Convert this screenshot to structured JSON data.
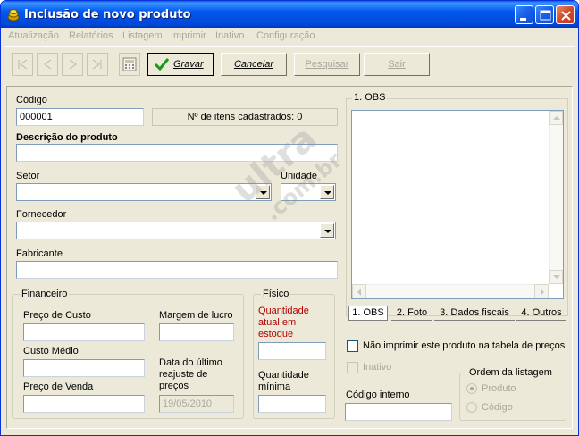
{
  "window": {
    "title": "Inclusão de novo produto",
    "controls": [
      "minimize",
      "maximize",
      "close"
    ]
  },
  "menu": {
    "items": [
      "Atualização",
      "Relatórios",
      "Listagem",
      "Imprimir",
      "Inativo",
      "Configuração"
    ]
  },
  "toolbar": {
    "nav_icons": [
      "first-record-icon",
      "previous-record-icon",
      "next-record-icon",
      "last-record-icon",
      "calculator-icon"
    ],
    "save_label": "Gravar",
    "cancel_label": "Cancelar",
    "search_label": "Pesquisar",
    "exit_label": "Sair"
  },
  "form": {
    "codigo_label": "Código",
    "codigo_value": "000001",
    "items_count": "Nº de itens cadastrados: 0",
    "descricao_label": "Descrição do produto",
    "descricao_value": "",
    "setor_label": "Setor",
    "unidade_label": "Unidade",
    "fornecedor_label": "Fornecedor",
    "fabricante_label": "Fabricante"
  },
  "financeiro": {
    "title": "Financeiro",
    "preco_custo_label": "Preço de Custo",
    "margem_lucro_label": "Margem de lucro",
    "custo_medio_label": "Custo Médio",
    "data_reajuste_label_1": "Data do último",
    "data_reajuste_label_2": "reajuste de",
    "data_reajuste_label_3": "preços",
    "data_reajuste_value": "19/05/2010",
    "preco_venda_label": "Preço de Venda"
  },
  "fisico": {
    "title": "Físico",
    "qtd_atual_label_1": "Quantidade",
    "qtd_atual_label_2": "atual em",
    "qtd_atual_label_3": "estoque",
    "qtd_minima_label_1": "Quantidade",
    "qtd_minima_label_2": "mínima"
  },
  "obs": {
    "title": "1. OBS",
    "tabs": [
      "1. OBS",
      "2. Foto",
      "3. Dados fiscais",
      "4. Outros"
    ]
  },
  "options": {
    "nao_imprimir_label": "Não imprimir este produto na tabela de preços",
    "inativo_label": "Inativo",
    "codigo_interno_label": "Código interno",
    "ordem_title": "Ordem da listagem",
    "ordem_produto_label": "Produto",
    "ordem_codigo_label": "Código"
  },
  "watermark": {
    "line1": "ultra",
    "line2": ".com.br"
  },
  "colors": {
    "titlebar": "#0058ee",
    "window_bg": "#ece9d8",
    "red_label": "#b00000",
    "save_check": "#1a9a1a"
  }
}
